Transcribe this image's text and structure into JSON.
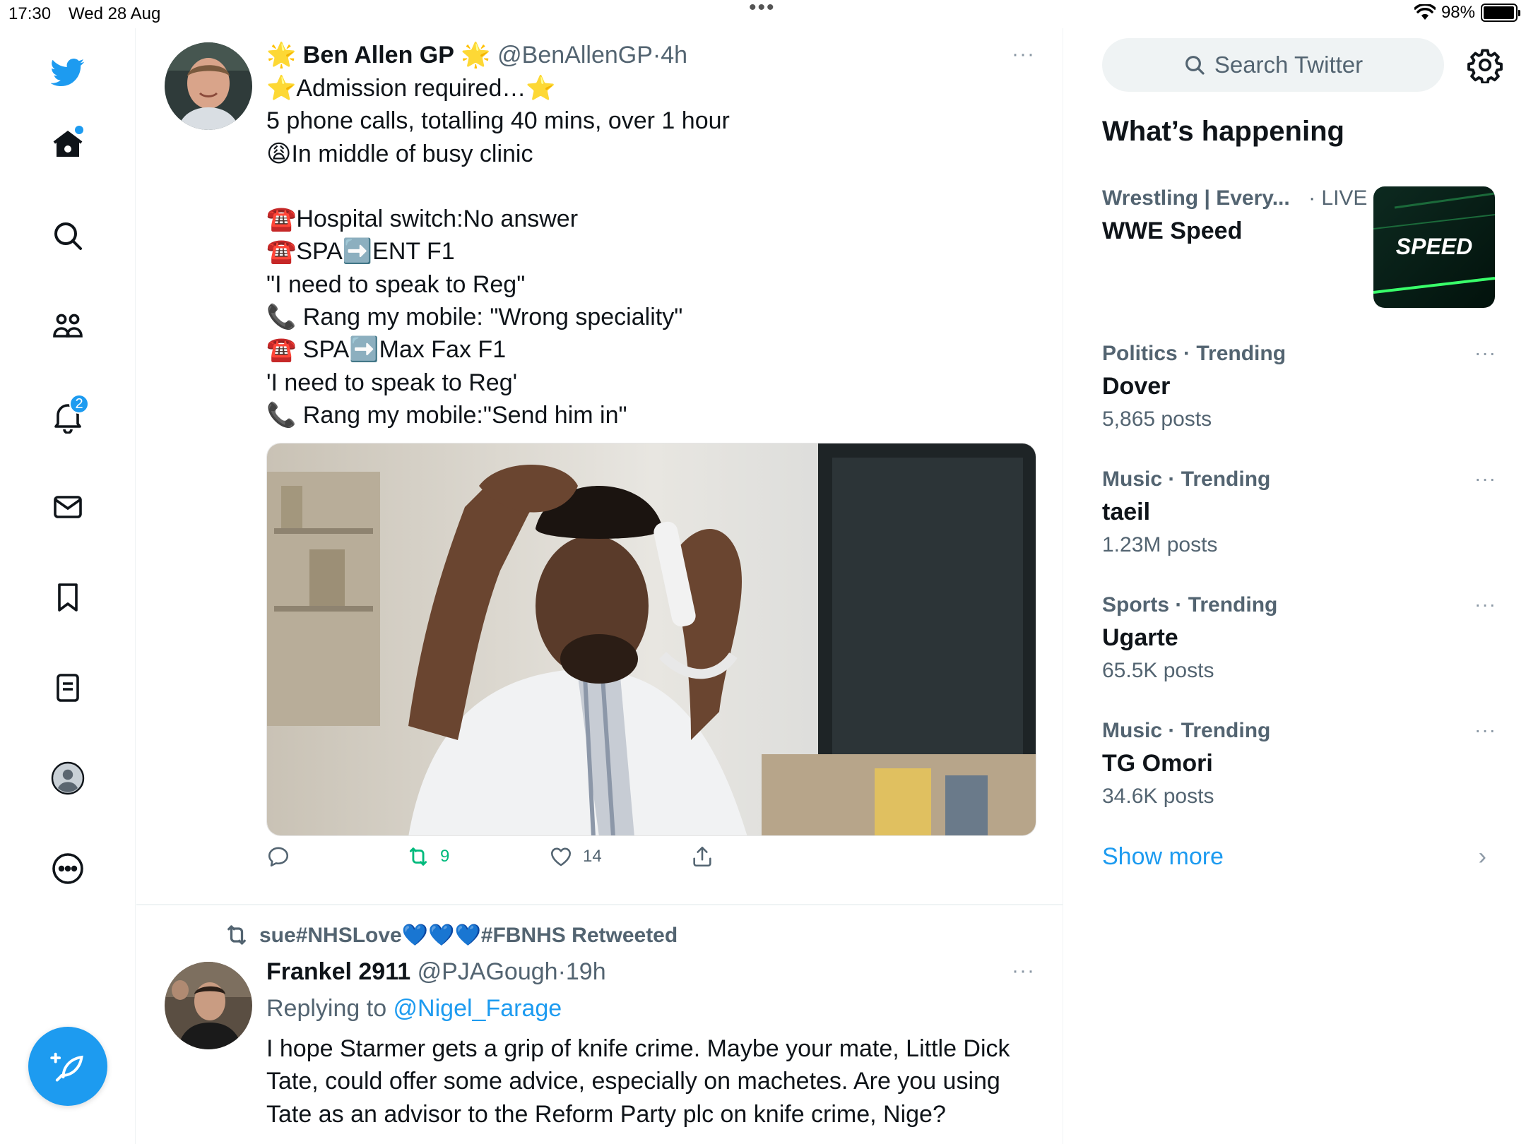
{
  "status_bar": {
    "time": "17:30",
    "date": "Wed 28 Aug",
    "battery": "98%",
    "battery_level": 0.98
  },
  "nav": {
    "notifications_badge": "2",
    "icons": [
      "twitter-logo-icon",
      "home-icon",
      "search-icon",
      "communities-icon",
      "bell-icon",
      "mail-icon",
      "bookmark-icon",
      "lists-icon",
      "profile-icon",
      "more-icon",
      "compose-icon"
    ]
  },
  "tweet1": {
    "name": "Ben Allen GP",
    "name_star_left": "🌟",
    "name_star_right": "🌟",
    "handle": "@BenAllenGP",
    "sep": "·",
    "time": "4h",
    "more": "···",
    "text": "⭐Admission required…⭐\n5 phone calls, totalling 40 mins, over 1 hour\n😩In middle of busy clinic\n\n☎️Hospital switch:No answer\n☎️SPA➡️ENT F1\n\"I need to speak to Reg\"\n📞 Rang my mobile: \"Wrong speciality\"\n☎️ SPA➡️Max Fax F1\n'I need to speak to Reg'\n📞 Rang my mobile:\"Send him in\"",
    "actions": {
      "reply": "",
      "retweets": "9",
      "likes": "14"
    }
  },
  "tweet2": {
    "retweeted_by": "sue#NHSLove💙💙💙#FBNHS Retweeted",
    "name": "Frankel 2911",
    "handle": "@PJAGough",
    "sep": "·",
    "time": "19h",
    "more": "···",
    "replying_prefix": "Replying to ",
    "replying_handle": "@Nigel_Farage",
    "text": "I hope Starmer gets a grip of knife crime. Maybe your mate, Little Dick Tate, could offer some advice, especially on machetes. Are you using Tate as an advisor to the Reform Party plc on knife crime, Nige?"
  },
  "sidebar": {
    "search_placeholder": "Search Twitter",
    "section_title": "What’s happening",
    "featured": {
      "category": "Wrestling | Every...",
      "live": "· LIVE",
      "title": "WWE Speed",
      "thumb_text": "SPEED"
    },
    "trends": [
      {
        "category": "Politics",
        "label": "Trending",
        "title": "Dover",
        "count": "5,865 posts"
      },
      {
        "category": "Music",
        "label": "Trending",
        "title": "taeil",
        "count": "1.23M posts"
      },
      {
        "category": "Sports",
        "label": "Trending",
        "title": "Ugarte",
        "count": "65.5K posts"
      },
      {
        "category": "Music",
        "label": "Trending",
        "title": "TG Omori",
        "count": "34.6K posts"
      }
    ],
    "trend_sep": " · ",
    "trend_more": "···",
    "show_more": "Show more",
    "show_more_chevron": "›"
  },
  "colors": {
    "accent": "#1d9bf0",
    "retweet": "#00ba7c",
    "text": "#0f1419",
    "muted": "#536471"
  }
}
